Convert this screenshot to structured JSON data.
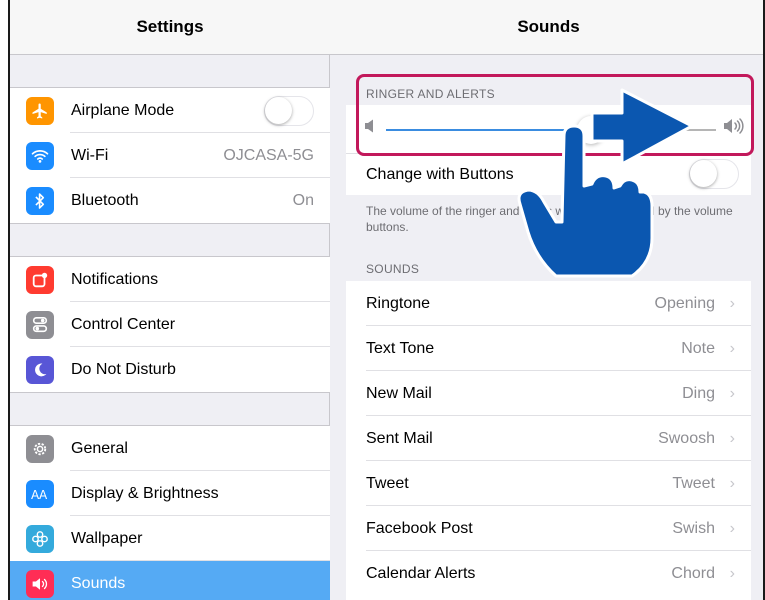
{
  "left": {
    "title": "Settings",
    "groups": [
      [
        {
          "label": "Airplane Mode",
          "icon": "airplane-icon",
          "color": "#ff9500",
          "toggle": true
        },
        {
          "label": "Wi-Fi",
          "icon": "wifi-icon",
          "color": "#1a8cff",
          "value": "OJCASA-5G"
        },
        {
          "label": "Bluetooth",
          "icon": "bluetooth-icon",
          "color": "#1a8cff",
          "value": "On"
        }
      ],
      [
        {
          "label": "Notifications",
          "icon": "notifications-icon",
          "color": "#ff3b30"
        },
        {
          "label": "Control Center",
          "icon": "control-center-icon",
          "color": "#8e8e93"
        },
        {
          "label": "Do Not Disturb",
          "icon": "moon-icon",
          "color": "#5856d6"
        }
      ],
      [
        {
          "label": "General",
          "icon": "gear-icon",
          "color": "#8e8e93"
        },
        {
          "label": "Display & Brightness",
          "icon": "display-brightness-icon",
          "color": "#1a8cff"
        },
        {
          "label": "Wallpaper",
          "icon": "wallpaper-icon",
          "color": "#34aadc"
        },
        {
          "label": "Sounds",
          "icon": "speaker-icon",
          "color": "#ff2d55",
          "selected": true
        }
      ]
    ]
  },
  "right": {
    "title": "Sounds",
    "ringer_section_title": "RINGER AND ALERTS",
    "ringer_volume": 0.62,
    "change_with_buttons_label": "Change with Buttons",
    "footnote": "The volume of the ringer and alerts will not be affected by the volume buttons.",
    "sounds_section_title": "SOUNDS",
    "sounds": [
      {
        "label": "Ringtone",
        "value": "Opening"
      },
      {
        "label": "Text Tone",
        "value": "Note"
      },
      {
        "label": "New Mail",
        "value": "Ding"
      },
      {
        "label": "Sent Mail",
        "value": "Swoosh"
      },
      {
        "label": "Tweet",
        "value": "Tweet"
      },
      {
        "label": "Facebook Post",
        "value": "Swish"
      },
      {
        "label": "Calendar Alerts",
        "value": "Chord"
      }
    ]
  },
  "colors": {
    "highlight": "#c2185b",
    "overlay": "#0b57b0",
    "selected_row": "#55aaf4"
  }
}
